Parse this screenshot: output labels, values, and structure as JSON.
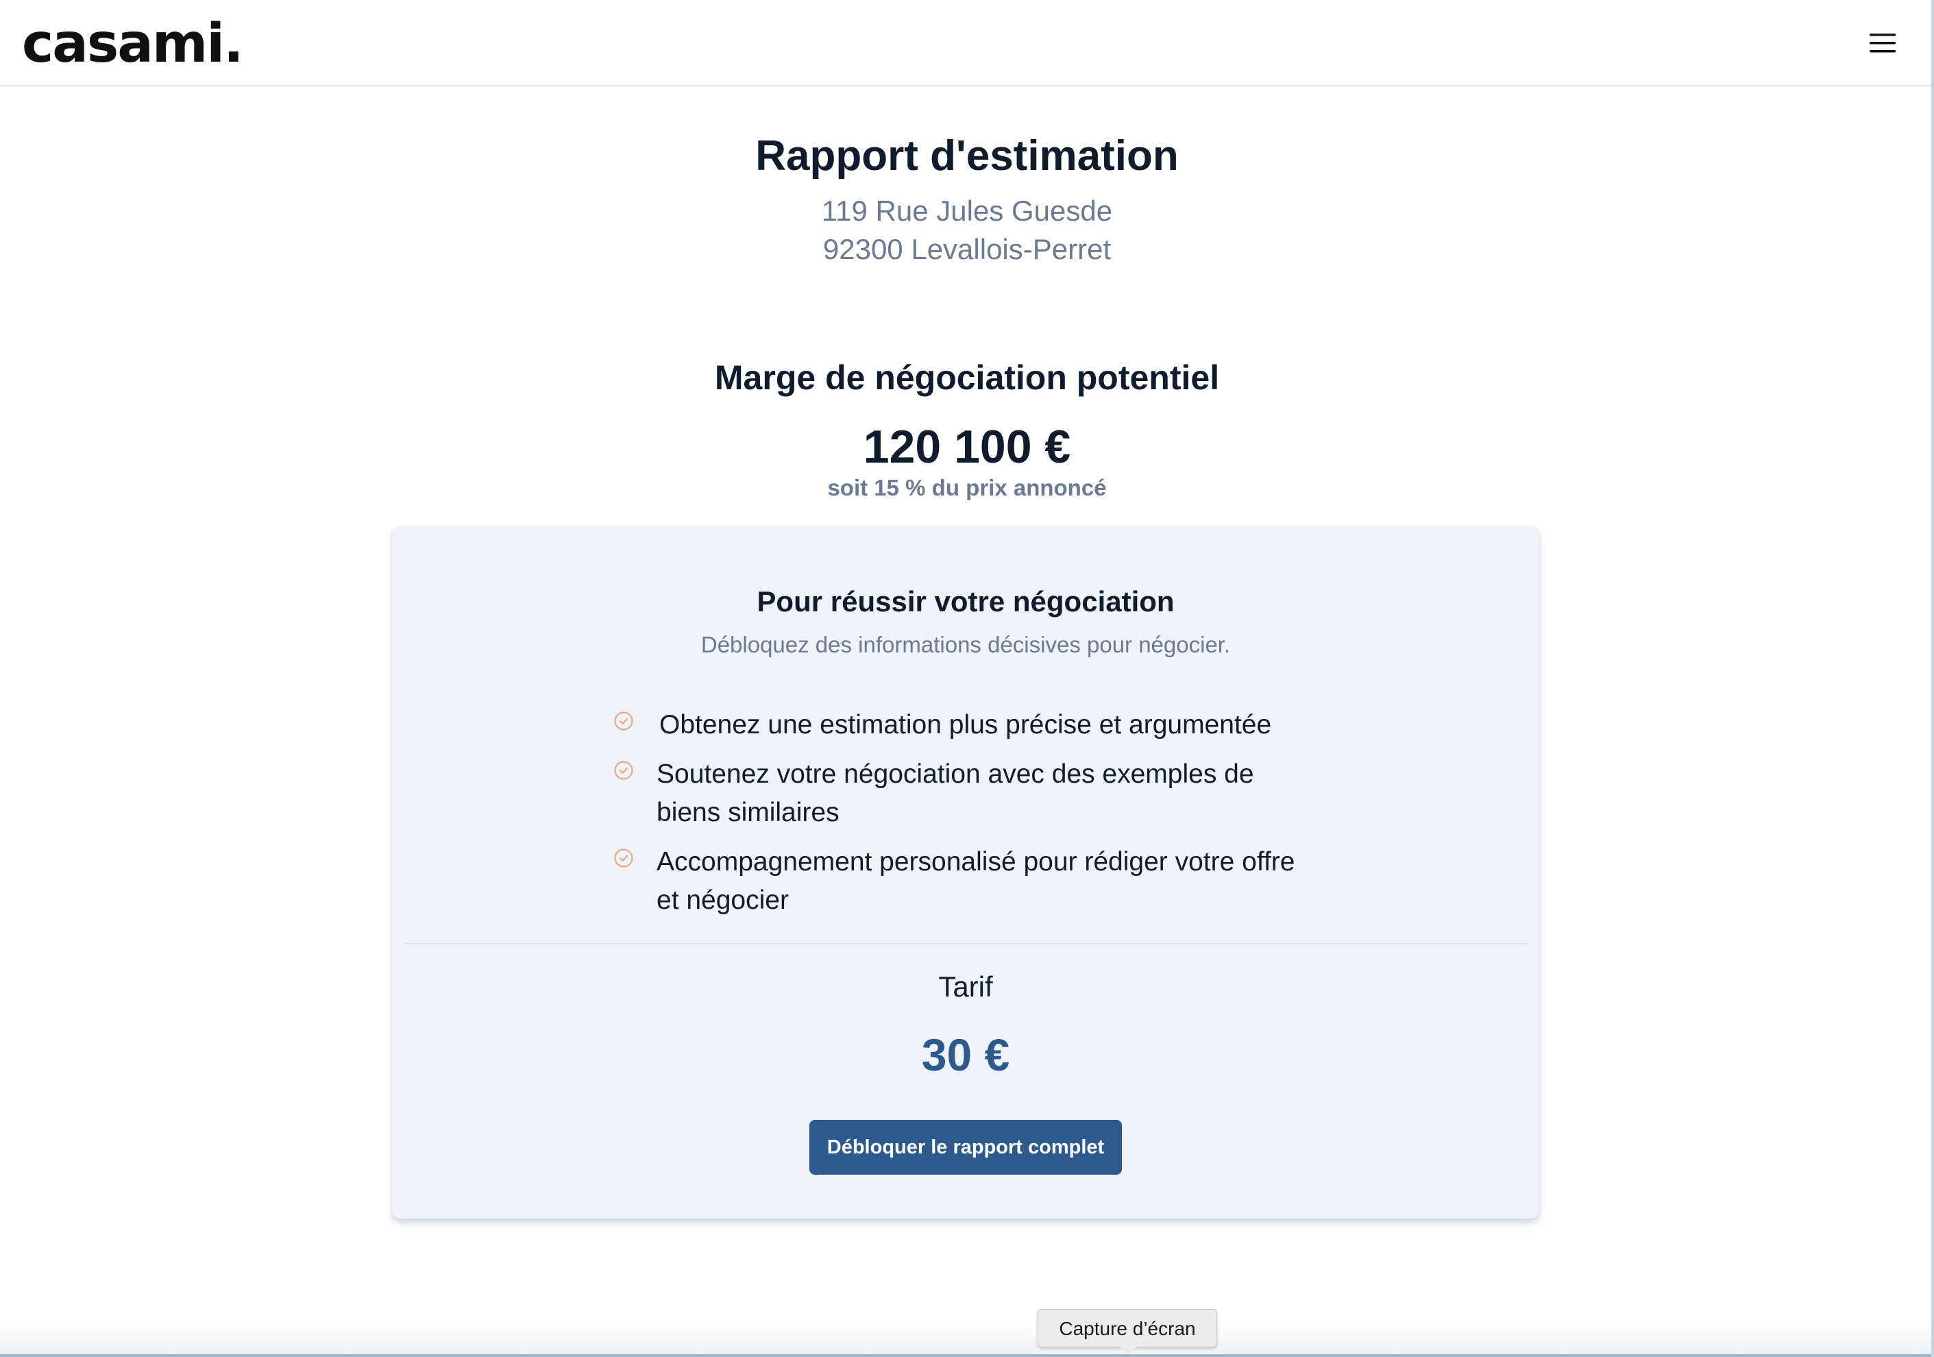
{
  "header": {
    "logo_text": "casami.",
    "menu_icon": "hamburger-menu-icon"
  },
  "report": {
    "title": "Rapport d'estimation",
    "address_line1": "119 Rue Jules Guesde",
    "address_line2": "92300 Levallois-Perret"
  },
  "negotiation": {
    "title": "Marge de négociation potentiel",
    "value": "120 100 €",
    "subtitle": "soit 15 % du prix annoncé"
  },
  "card": {
    "title": "Pour réussir votre négociation",
    "subtitle": "Débloquez des informations décisives pour négocier.",
    "features": [
      {
        "text": "Obtenez une estimation plus précise et argumentée",
        "icon": "check-circle-icon"
      },
      {
        "text": "Soutenez votre négociation avec des exemples de biens similaires",
        "icon": "check-circle-icon"
      },
      {
        "text": "Accompagnement personalisé pour rédiger votre offre et négocier",
        "icon": "check-circle-icon"
      }
    ],
    "tarif_label": "Tarif",
    "tarif_value": "30 €",
    "cta_label": "Débloquer le rapport complet"
  },
  "system": {
    "tooltip_text": "Capture d’écran"
  },
  "colors": {
    "primary": "#2c5a8c",
    "heading": "#0f1c2e",
    "muted": "#6a7a90",
    "card_bg": "#eff2f6",
    "check_icon": "#e8a98a"
  }
}
